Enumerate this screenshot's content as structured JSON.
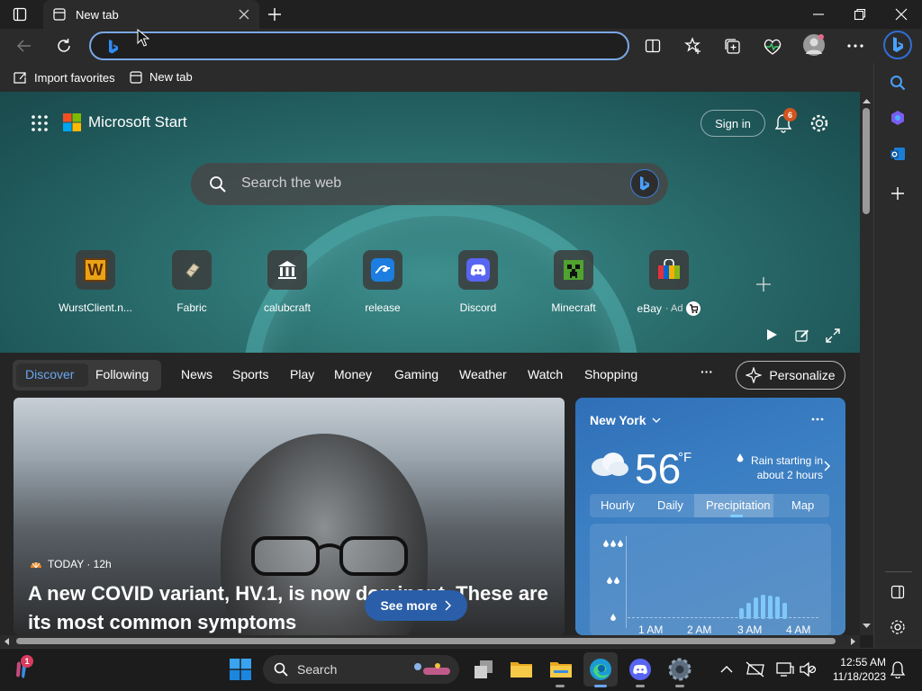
{
  "browser": {
    "tab_title": "New tab",
    "favorites": [
      {
        "label": "Import favorites"
      },
      {
        "label": "New tab"
      }
    ]
  },
  "newtab": {
    "brand": "Microsoft Start",
    "sign_in": "Sign in",
    "notification_count": "6",
    "search_placeholder": "Search the web",
    "quick_links": [
      {
        "label": "WurstClient.n...",
        "icon": "wurst-icon"
      },
      {
        "label": "Fabric",
        "icon": "fabric-icon"
      },
      {
        "label": "calubcraft",
        "icon": "building-icon"
      },
      {
        "label": "release",
        "icon": "release-icon"
      },
      {
        "label": "Discord",
        "icon": "discord-icon"
      },
      {
        "label": "Minecraft",
        "icon": "minecraft-icon"
      },
      {
        "label": "eBay",
        "icon": "ebay-icon",
        "ad": "· Ad"
      }
    ]
  },
  "feed": {
    "tabs": [
      "Discover",
      "Following",
      "News",
      "Sports",
      "Play",
      "Money",
      "Gaming",
      "Weather",
      "Watch",
      "Shopping"
    ],
    "more": "···",
    "personalize": "Personalize",
    "story": {
      "source": "TODAY · 12h",
      "headline": "A new COVID variant, HV.1, is now dominant. These are its most common symptoms",
      "see_more": "See more"
    },
    "weather": {
      "location": "New York",
      "temperature": "56",
      "unit": "°F",
      "alert": "Rain starting in about 2 hours",
      "tabs": [
        "Hourly",
        "Daily",
        "Precipitation",
        "Map"
      ],
      "selected_tab": "Precipitation",
      "chart_labels": [
        "1 AM",
        "2 AM",
        "3 AM",
        "4 AM"
      ]
    }
  },
  "taskbar": {
    "search": "Search",
    "time": "12:55 AM",
    "date": "11/18/2023",
    "widget_badge": "1"
  },
  "colors": {
    "accent": "#2a5ea8",
    "address_border": "#7aa8e6",
    "notification_badge": "#d2541e"
  }
}
